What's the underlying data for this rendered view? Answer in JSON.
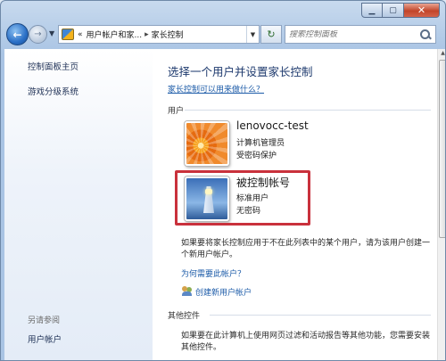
{
  "navbar": {
    "address_root": "«",
    "address_parent": "用户帐户和家...",
    "address_current": "家长控制",
    "search_placeholder": "搜索控制面板"
  },
  "sidebar": {
    "items": [
      {
        "label": "控制面板主页"
      },
      {
        "label": "游戏分级系统"
      }
    ],
    "see_also_label": "另请参阅",
    "see_also_items": [
      {
        "label": "用户帐户"
      }
    ]
  },
  "main": {
    "heading": "选择一个用户并设置家长控制",
    "help_link": "家长控制可以用来做什么？",
    "users_group_label": "用户",
    "users": [
      {
        "name": "lenovocc-test",
        "role": "计算机管理员",
        "status": "受密码保护",
        "avatar": "orange-flower"
      },
      {
        "name": "被控制帐号",
        "role": "标准用户",
        "status": "无密码",
        "avatar": "lighthouse"
      }
    ],
    "new_user_text": "如果要将家长控制应用于不在此列表中的某个用户，请为该用户创建一个新用户帐户。",
    "why_link": "为何需要此帐户？",
    "create_link": "创建新用户帐户",
    "other_group_label": "其他控件",
    "other_text": "如果要在此计算机上使用网页过滤和活动报告等其他功能，您需要安装其他控件。"
  },
  "colors": {
    "highlight": "#c9313c",
    "link": "#1c5ba8",
    "heading": "#1e3a6e"
  }
}
